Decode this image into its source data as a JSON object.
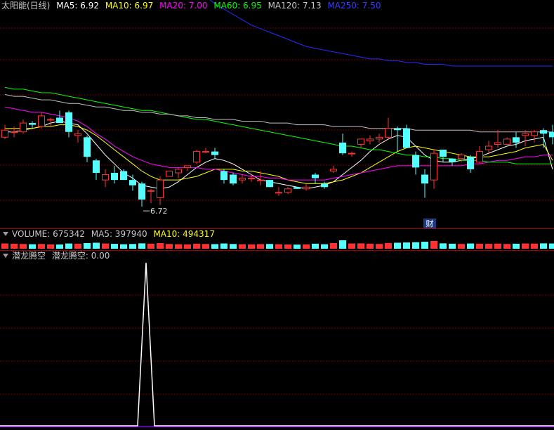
{
  "colors": {
    "up": "#ff3232",
    "down": "#54ffff",
    "ma5": "#ffffff",
    "ma10": "#ffff00",
    "ma20": "#ff00ff",
    "ma60": "#00ff00",
    "ma120": "#c0c0c0",
    "ma250": "#2a2aff",
    "grid": "#8b0000",
    "separator": "#a00000",
    "signal": "#ffffff"
  },
  "price_panel": {
    "title": "太阳能(日线)",
    "ma5_label": "MA5: 6.92",
    "ma10_label": "MA10: 6.97",
    "ma20_label": "MA20: 7.00",
    "ma60_label": "MA60: 6.95",
    "ma120_label": "MA120: 7.13",
    "ma250_label": "MA250: 7.50",
    "low_marker": "6.72",
    "badge": "财"
  },
  "volume_panel": {
    "title": "VOLUME: 675342",
    "ma5_label": "MA5: 397940",
    "ma10_label": "MA10: 494317"
  },
  "indicator_panel": {
    "name": "潜龙腾空",
    "value_label": "潜龙腾空: 0.00"
  },
  "chart_data": [
    {
      "type": "candlestick",
      "title": "太阳能(日线)",
      "ylim": [
        6.6,
        7.8
      ],
      "series": [
        {
          "name": "K",
          "ohlc": [
            [
              7.1,
              7.17,
              7.09,
              7.14
            ],
            [
              7.13,
              7.16,
              7.1,
              7.13
            ],
            [
              7.13,
              7.2,
              7.12,
              7.18
            ],
            [
              7.18,
              7.19,
              7.15,
              7.17
            ],
            [
              7.16,
              7.24,
              7.15,
              7.22
            ],
            [
              7.2,
              7.21,
              7.16,
              7.2
            ],
            [
              7.21,
              7.25,
              7.18,
              7.18
            ],
            [
              7.24,
              7.25,
              7.1,
              7.13
            ],
            [
              7.11,
              7.14,
              7.07,
              7.12
            ],
            [
              7.1,
              7.11,
              6.96,
              6.99
            ],
            [
              6.97,
              6.98,
              6.86,
              6.9
            ],
            [
              6.86,
              6.92,
              6.82,
              6.89
            ],
            [
              6.9,
              6.94,
              6.84,
              6.86
            ],
            [
              6.91,
              6.92,
              6.86,
              6.86
            ],
            [
              6.86,
              6.89,
              6.8,
              6.83
            ],
            [
              6.84,
              6.85,
              6.71,
              6.75
            ],
            [
              6.8,
              6.81,
              6.73,
              6.8
            ],
            [
              6.76,
              6.88,
              6.72,
              6.86
            ],
            [
              6.88,
              6.91,
              6.88,
              6.91
            ],
            [
              6.9,
              6.93,
              6.87,
              6.92
            ],
            [
              6.93,
              6.94,
              6.91,
              6.94
            ],
            [
              6.96,
              7.03,
              6.95,
              7.02
            ],
            [
              7.02,
              7.04,
              7.01,
              7.02
            ],
            [
              7.02,
              7.04,
              6.98,
              7.0
            ],
            [
              6.91,
              6.92,
              6.84,
              6.86
            ],
            [
              6.89,
              6.9,
              6.83,
              6.84
            ],
            [
              6.86,
              6.89,
              6.84,
              6.87
            ],
            [
              6.87,
              6.89,
              6.85,
              6.87
            ],
            [
              6.86,
              6.91,
              6.83,
              6.86
            ],
            [
              6.86,
              6.86,
              6.82,
              6.82
            ],
            [
              6.79,
              6.82,
              6.77,
              6.79
            ],
            [
              6.79,
              6.82,
              6.78,
              6.81
            ],
            [
              6.82,
              6.82,
              6.81,
              6.81
            ],
            [
              6.81,
              6.84,
              6.8,
              6.82
            ],
            [
              6.89,
              6.9,
              6.84,
              6.87
            ],
            [
              6.84,
              6.85,
              6.81,
              6.82
            ],
            [
              6.91,
              6.94,
              6.9,
              6.92
            ],
            [
              7.07,
              7.12,
              7.0,
              7.01
            ],
            [
              7.01,
              7.02,
              6.99,
              7.01
            ],
            [
              7.06,
              7.09,
              7.04,
              7.09
            ],
            [
              7.08,
              7.11,
              7.06,
              7.09
            ],
            [
              7.09,
              7.12,
              7.07,
              7.1
            ],
            [
              7.1,
              7.21,
              7.09,
              7.15
            ],
            [
              7.15,
              7.16,
              7.02,
              7.14
            ],
            [
              7.15,
              7.17,
              7.08,
              7.04
            ],
            [
              7.0,
              7.02,
              6.89,
              6.93
            ],
            [
              6.89,
              6.92,
              6.76,
              6.84
            ],
            [
              6.86,
              7.03,
              6.81,
              7.01
            ],
            [
              7.03,
              7.03,
              6.96,
              6.99
            ],
            [
              6.98,
              6.98,
              6.94,
              6.96
            ],
            [
              6.98,
              7.01,
              6.96,
              7.0
            ],
            [
              6.99,
              7.0,
              6.9,
              6.92
            ],
            [
              6.96,
              7.05,
              6.95,
              7.02
            ],
            [
              7.03,
              7.08,
              7.01,
              7.05
            ],
            [
              7.06,
              7.14,
              7.04,
              7.07
            ],
            [
              7.06,
              7.1,
              7.06,
              7.09
            ],
            [
              7.1,
              7.13,
              7.04,
              7.07
            ],
            [
              7.11,
              7.14,
              7.05,
              7.12
            ],
            [
              7.11,
              7.14,
              7.07,
              7.13
            ],
            [
              7.14,
              7.15,
              7.04,
              7.12
            ],
            [
              7.13,
              7.17,
              7.06,
              7.1
            ]
          ]
        },
        {
          "name": "MA5",
          "values": [
            7.13,
            7.13,
            7.14,
            7.15,
            7.16,
            7.18,
            7.19,
            7.18,
            7.17,
            7.12,
            7.06,
            7.0,
            6.95,
            6.9,
            6.87,
            6.83,
            6.82,
            6.81,
            6.82,
            6.85,
            6.89,
            6.93,
            6.96,
            6.98,
            6.97,
            6.95,
            6.92,
            6.89,
            6.86,
            6.85,
            6.84,
            6.83,
            6.82,
            6.81,
            6.82,
            6.83,
            6.85,
            6.89,
            6.93,
            6.97,
            7.02,
            7.06,
            7.09,
            7.11,
            7.1,
            7.05,
            7.0,
            6.97,
            6.96,
            6.96,
            6.97,
            6.98,
            6.99,
            7.01,
            7.03,
            7.05,
            7.06,
            7.08,
            7.09,
            7.1,
            6.92
          ]
        },
        {
          "name": "MA10",
          "values": [
            7.15,
            7.15,
            7.15,
            7.15,
            7.16,
            7.16,
            7.17,
            7.17,
            7.16,
            7.14,
            7.11,
            7.07,
            7.03,
            6.99,
            6.95,
            6.91,
            6.88,
            6.86,
            6.86,
            6.86,
            6.87,
            6.88,
            6.9,
            6.92,
            6.92,
            6.92,
            6.91,
            6.91,
            6.9,
            6.89,
            6.88,
            6.86,
            6.85,
            6.84,
            6.84,
            6.84,
            6.85,
            6.86,
            6.88,
            6.9,
            6.93,
            6.96,
            6.99,
            7.02,
            7.04,
            7.05,
            7.04,
            7.03,
            7.02,
            7.01,
            7.0,
            6.99,
            6.99,
            6.99,
            7.0,
            7.01,
            7.02,
            7.04,
            7.05,
            7.06,
            6.97
          ]
        },
        {
          "name": "MA20",
          "values": [
            7.27,
            7.26,
            7.25,
            7.24,
            7.24,
            7.23,
            7.22,
            7.21,
            7.19,
            7.16,
            7.12,
            7.09,
            7.05,
            7.02,
            6.99,
            6.97,
            6.95,
            6.94,
            6.93,
            6.93,
            6.93,
            6.93,
            6.92,
            6.92,
            6.91,
            6.9,
            6.89,
            6.88,
            6.88,
            6.87,
            6.87,
            6.86,
            6.86,
            6.86,
            6.86,
            6.86,
            6.87,
            6.88,
            6.89,
            6.9,
            6.91,
            6.92,
            6.93,
            6.94,
            6.94,
            6.94,
            6.94,
            6.94,
            6.94,
            6.94,
            6.94,
            6.95,
            6.95,
            6.96,
            6.97,
            6.97,
            6.98,
            6.99,
            6.99,
            7.0,
            7.0
          ]
        },
        {
          "name": "MA60",
          "values": [
            7.38,
            7.37,
            7.37,
            7.36,
            7.35,
            7.35,
            7.34,
            7.33,
            7.32,
            7.31,
            7.3,
            7.29,
            7.28,
            7.27,
            7.26,
            7.25,
            7.25,
            7.24,
            7.23,
            7.22,
            7.21,
            7.2,
            7.2,
            7.19,
            7.18,
            7.17,
            7.16,
            7.15,
            7.14,
            7.13,
            7.12,
            7.11,
            7.1,
            7.09,
            7.08,
            7.07,
            7.06,
            7.05,
            7.05,
            7.04,
            7.03,
            7.03,
            7.02,
            7.01,
            7.0,
            7.0,
            6.99,
            6.99,
            6.98,
            6.98,
            6.97,
            6.97,
            6.97,
            6.96,
            6.96,
            6.96,
            6.95,
            6.95,
            6.95,
            6.95,
            6.95
          ]
        },
        {
          "name": "MA120",
          "values": [
            7.34,
            7.33,
            7.33,
            7.32,
            7.31,
            7.31,
            7.3,
            7.29,
            7.29,
            7.28,
            7.27,
            7.27,
            7.26,
            7.25,
            7.25,
            7.24,
            7.24,
            7.23,
            7.23,
            7.22,
            7.22,
            7.21,
            7.21,
            7.2,
            7.2,
            7.2,
            7.19,
            7.19,
            7.19,
            7.18,
            7.18,
            7.18,
            7.17,
            7.17,
            7.17,
            7.17,
            7.16,
            7.16,
            7.16,
            7.16,
            7.15,
            7.15,
            7.15,
            7.15,
            7.15,
            7.14,
            7.14,
            7.14,
            7.14,
            7.14,
            7.14,
            7.14,
            7.13,
            7.13,
            7.13,
            7.13,
            7.13,
            7.13,
            7.13,
            7.13,
            7.13
          ]
        },
        {
          "name": "MA250",
          "values": [
            8.43,
            8.42,
            8.41,
            8.4,
            8.39,
            8.38,
            8.37,
            8.36,
            8.34,
            8.32,
            8.3,
            8.28,
            8.26,
            8.23,
            8.2,
            8.17,
            8.13,
            8.09,
            8.05,
            8.01,
            7.97,
            7.93,
            7.89,
            7.85,
            7.82,
            7.79,
            7.76,
            7.73,
            7.71,
            7.69,
            7.67,
            7.65,
            7.63,
            7.61,
            7.6,
            7.59,
            7.58,
            7.57,
            7.56,
            7.55,
            7.54,
            7.54,
            7.53,
            7.53,
            7.52,
            7.52,
            7.51,
            7.51,
            7.51,
            7.5,
            7.5,
            7.5,
            7.5,
            7.5,
            7.5,
            7.5,
            7.5,
            7.5,
            7.5,
            7.5,
            7.5
          ]
        }
      ]
    },
    {
      "type": "bar",
      "title": "VOLUME",
      "series": [
        {
          "name": "VOLUME",
          "values": [
            420000,
            400000,
            380000,
            360000,
            380000,
            350000,
            340000,
            420000,
            400000,
            450000,
            480000,
            420000,
            390000,
            360000,
            380000,
            430000,
            400000,
            450000,
            380000,
            360000,
            350000,
            400000,
            380000,
            370000,
            420000,
            380000,
            360000,
            350000,
            370000,
            380000,
            360000,
            340000,
            330000,
            350000,
            400000,
            360000,
            450000,
            675342,
            420000,
            430000,
            400000,
            380000,
            460000,
            480000,
            500000,
            520000,
            560000,
            620000,
            430000,
            400000,
            380000,
            420000,
            400000,
            390000,
            410000,
            380000,
            400000,
            420000,
            410000,
            430000,
            420000
          ]
        }
      ]
    },
    {
      "type": "line",
      "title": "潜龙腾空",
      "ylim": [
        0,
        1
      ],
      "series": [
        {
          "name": "潜龙腾空",
          "values": [
            0,
            0,
            0,
            0,
            0,
            0,
            0,
            0,
            0,
            0,
            0,
            0,
            0,
            0,
            0,
            1,
            0,
            0,
            0,
            0,
            0,
            0,
            0,
            0,
            0,
            0,
            0,
            0,
            0,
            0,
            0,
            0,
            0,
            0,
            0,
            0,
            0,
            0,
            0,
            0,
            0,
            0,
            0,
            0,
            0,
            0,
            0,
            0,
            0,
            0,
            0,
            0,
            0,
            0,
            0,
            0,
            0,
            0,
            0,
            0,
            0
          ]
        }
      ]
    }
  ]
}
